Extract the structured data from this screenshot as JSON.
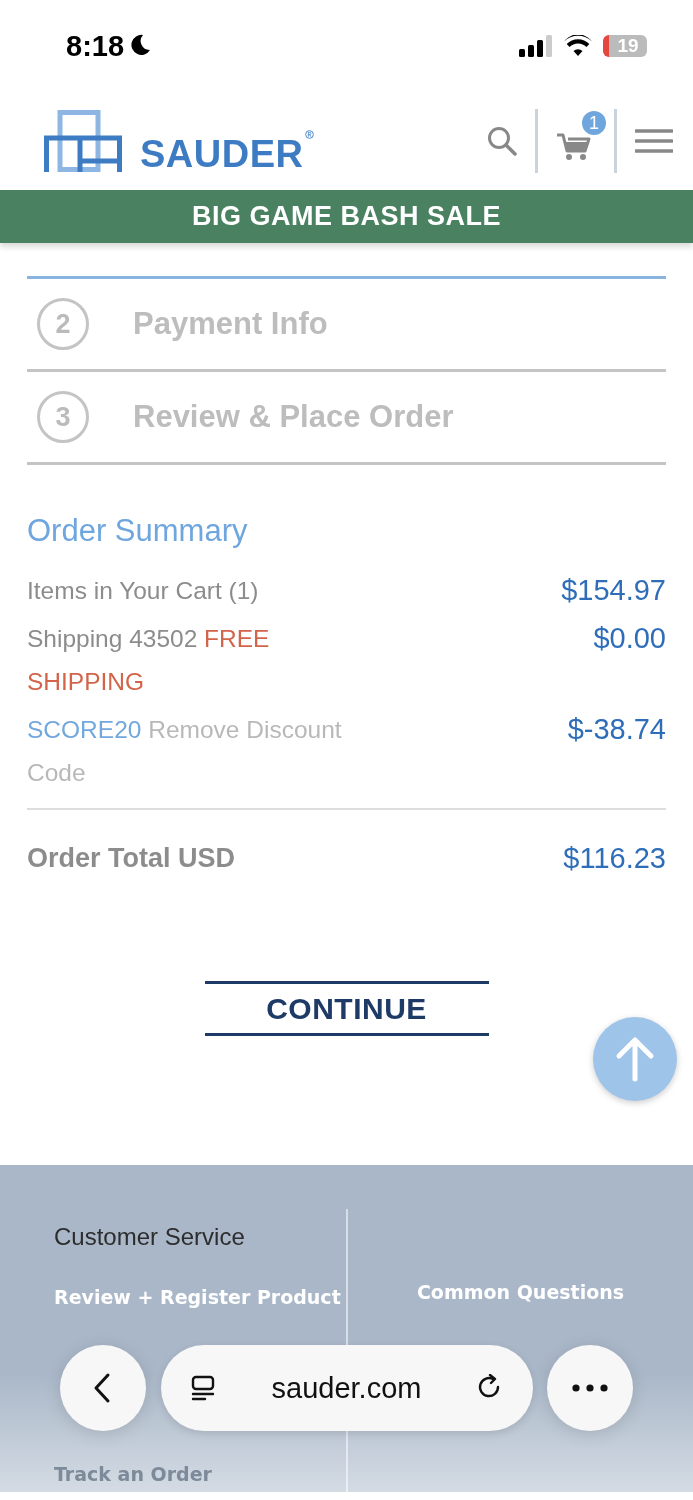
{
  "status_bar": {
    "time": "8:18",
    "battery": "19"
  },
  "header": {
    "brand": "SAUDER",
    "cart_count": "1"
  },
  "banner": {
    "text": "BIG GAME BASH SALE"
  },
  "steps": [
    {
      "number": "2",
      "label": "Payment Info",
      "selected": false
    },
    {
      "number": "3",
      "label": "Review & Place Order",
      "selected": false
    }
  ],
  "summary": {
    "title": "Order Summary",
    "rows": [
      {
        "parts": [
          {
            "text": "Items in Your Cart (1)",
            "kind": "plain"
          }
        ],
        "amount": "$154.97"
      },
      {
        "parts": [
          {
            "text": "Shipping 43502",
            "kind": "plain"
          },
          {
            "text": "FREE SHIPPING",
            "kind": "promo"
          }
        ],
        "amount": "$0.00"
      },
      {
        "parts": [
          {
            "text": "SCORE20",
            "kind": "code"
          },
          {
            "text": "Remove Discount Code",
            "kind": "link"
          }
        ],
        "amount": "$-38.74"
      }
    ],
    "total_label": "Order Total USD",
    "total": "$116.23"
  },
  "continue_button": "CONTINUE",
  "footer": {
    "heading": "Customer Service",
    "left_links": [
      "Review + Register Product",
      "Track an Order"
    ],
    "right_links": [
      "Common Questions"
    ]
  },
  "browser": {
    "url": "sauder.com"
  }
}
